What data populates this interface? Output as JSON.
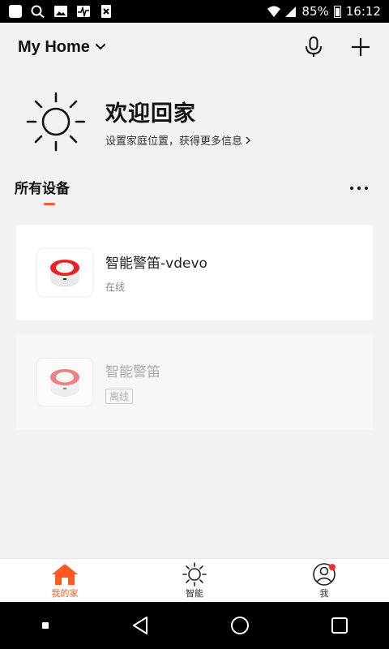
{
  "status_bar": {
    "battery": "85%",
    "time": "16:12",
    "left_icons": [
      "square-icon",
      "search-icon",
      "image-icon",
      "heartbeat-icon",
      "x-box-icon"
    ]
  },
  "header": {
    "home_name": "My Home"
  },
  "welcome": {
    "title": "欢迎回家",
    "subtitle": "设置家庭位置，获得更多信息"
  },
  "section": {
    "title": "所有设备"
  },
  "devices": [
    {
      "name": "智能警笛-vdevo",
      "status": "在线",
      "online": true
    },
    {
      "name": "智能警笛",
      "status": "离线",
      "online": false
    }
  ],
  "tabs": [
    {
      "label": "我的家",
      "icon": "home-icon",
      "active": true
    },
    {
      "label": "智能",
      "icon": "sun-icon",
      "active": false
    },
    {
      "label": "我",
      "icon": "profile-icon",
      "active": false
    }
  ],
  "colors": {
    "accent": "#ff5a1f",
    "notification": "#ff2b2b"
  }
}
